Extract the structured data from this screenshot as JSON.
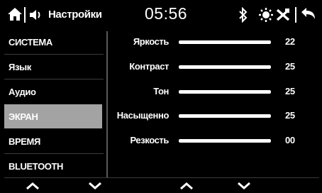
{
  "topbar": {
    "title": "Настройки",
    "clock": "05:56",
    "icons": [
      "home-icon",
      "volume-icon",
      "bluetooth-icon",
      "brightness-icon",
      "mute-icon",
      "back-icon"
    ]
  },
  "sidebar": {
    "items": [
      {
        "label": "СИСТЕМА",
        "selected": false
      },
      {
        "label": "Язык",
        "selected": false
      },
      {
        "label": "Аудио",
        "selected": false
      },
      {
        "label": "ЭКРАН",
        "selected": true
      },
      {
        "label": "ВРЕМЯ",
        "selected": false
      },
      {
        "label": "BLUETOOTH",
        "selected": false
      }
    ],
    "selected_color": "#a3a3a3"
  },
  "settings": [
    {
      "label": "Яркость",
      "value": "22",
      "level": 1.0
    },
    {
      "label": "Контраст",
      "value": "25",
      "level": 1.0
    },
    {
      "label": "Тон",
      "value": "25",
      "level": 1.0
    },
    {
      "label": "Насыщенно",
      "value": "25",
      "level": 1.0
    },
    {
      "label": "Резкость",
      "value": "00",
      "level": 1.0
    }
  ],
  "bottombar": {
    "icons": [
      "chevron-up-icon",
      "chevron-down-icon",
      "chevron-up-icon",
      "chevron-down-icon"
    ]
  }
}
